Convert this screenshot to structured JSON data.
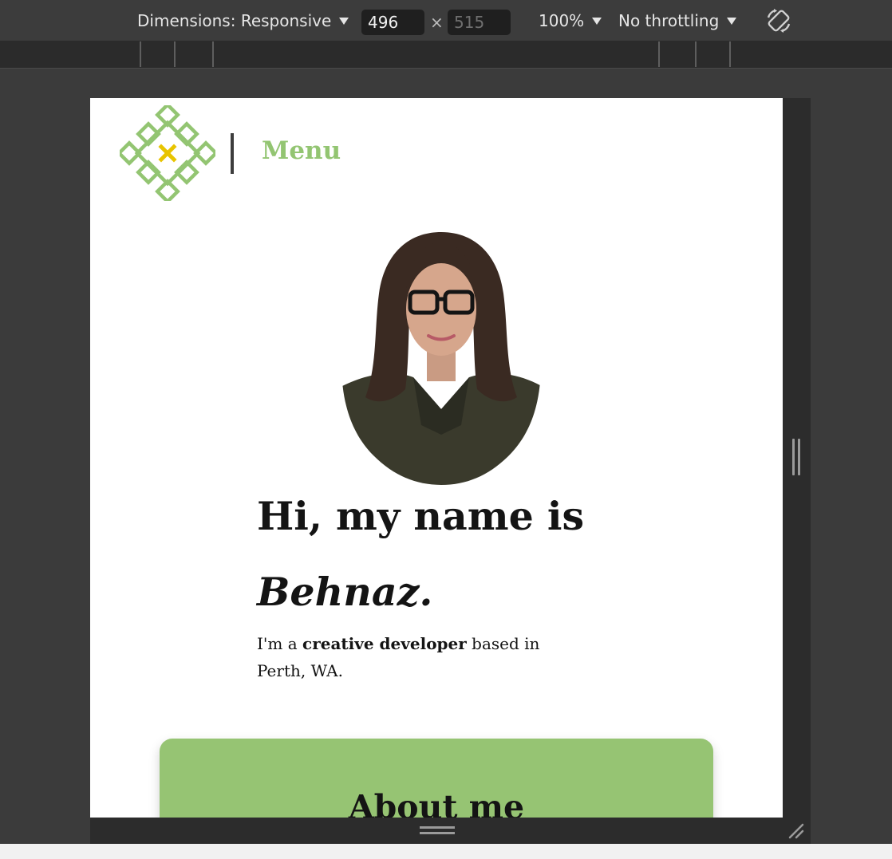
{
  "devtools": {
    "dimensions_label": "Dimensions: Responsive",
    "width_value": "496",
    "times": "×",
    "height_placeholder": "515",
    "zoom_label": "100%",
    "throttling_label": "No throttling"
  },
  "page": {
    "menu_label": "Menu",
    "headline_line1": "Hi, my name is",
    "headline_name": "Behnaz.",
    "intro_prefix": "I'm a ",
    "intro_bold": "creative developer",
    "intro_suffix": " based in Perth, WA.",
    "about_title": "About me"
  },
  "colors": {
    "accent_green": "#93c572",
    "card_green": "#96c473",
    "logo_yellow": "#e8c400"
  }
}
